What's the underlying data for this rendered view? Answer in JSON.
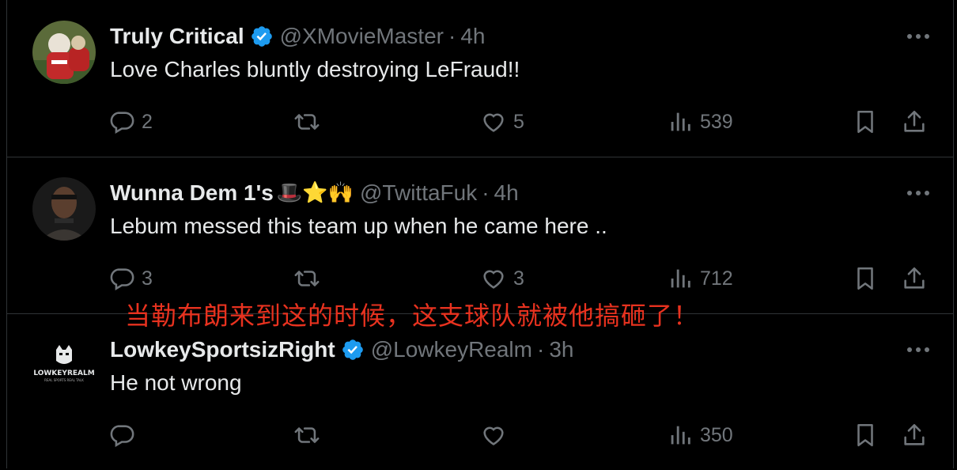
{
  "tweets": [
    {
      "name": "Truly Critical",
      "verified": true,
      "emojis": "",
      "handle": "@XMovieMaster",
      "time": "4h",
      "text": "Love Charles bluntly destroying LeFraud!!",
      "replies": "2",
      "retweets": "",
      "likes": "5",
      "views": "539",
      "avatar": {
        "bg": "#7a2b2b",
        "accent": "#d23a36"
      }
    },
    {
      "name": "Wunna Dem 1's",
      "verified": false,
      "emojis": "🎩⭐🙌",
      "handle": "@TwittaFuk",
      "time": "4h",
      "text": "Lebum messed this team up when he came here ..",
      "replies": "3",
      "retweets": "",
      "likes": "3",
      "views": "712",
      "avatar": {
        "bg": "#2a2a2a",
        "accent": "#4a3a30"
      }
    },
    {
      "name": "LowkeySportsizRight",
      "verified": true,
      "emojis": "",
      "handle": "@LowkeyRealm",
      "time": "3h",
      "text": "He not wrong",
      "replies": "",
      "retweets": "",
      "likes": "",
      "views": "350",
      "avatar": {
        "bg": "#000000",
        "accent": "#ffffff",
        "logo_text": "LOWKEYREALM",
        "logo_sub": "REAL SPORTS REAL TALK"
      }
    }
  ],
  "overlay_caption": "当勒布朗来到这的时候，这支球队就被他搞砸了！",
  "colors": {
    "background": "#000000",
    "text": "#e7e9ea",
    "muted": "#71767b",
    "border": "#2f3336",
    "verified": "#1d9bf0",
    "overlay": "#e8321f"
  },
  "icons": [
    "reply-icon",
    "retweet-icon",
    "like-icon",
    "views-icon",
    "bookmark-icon",
    "share-icon",
    "more-icon",
    "verified-badge-icon"
  ]
}
